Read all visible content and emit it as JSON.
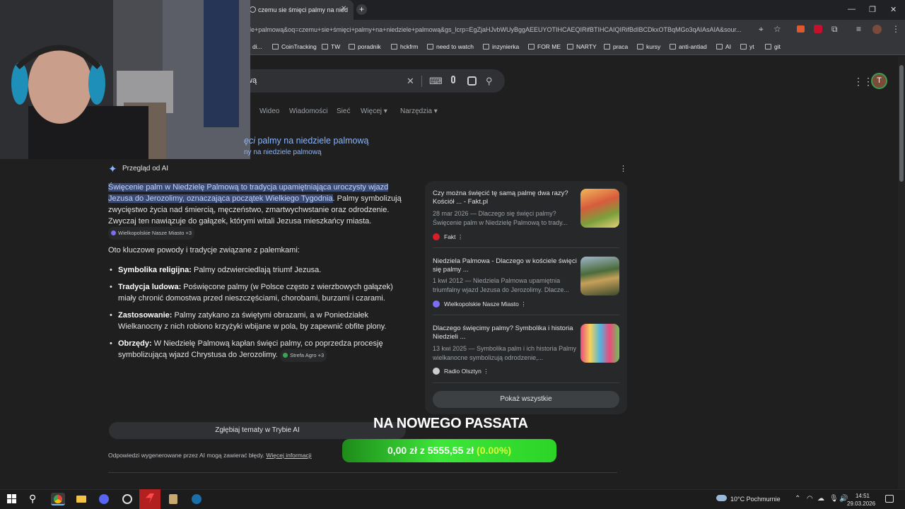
{
  "browser": {
    "tab_title": "czemu sie śmięci palmy na nied",
    "tab_close": "✕",
    "new_tab": "+",
    "window_controls": [
      "—",
      "❐",
      "✕"
    ],
    "url": "ele+palmową&oq=czemu+sie+śmięci+palmy+na+niedziele+palmową&gs_lcrp=EgZjaHJvbWUyBggAEEUYOTIHCAEQIRifBTIHCAIQIRifBdIBCDkxOTBqMGo3qAIAsAIA&sour..."
  },
  "bookmarks": [
    {
      "label": "di..."
    },
    {
      "label": "CoinTracking"
    },
    {
      "label": "TW"
    },
    {
      "label": "poradnik"
    },
    {
      "label": "hckfrm"
    },
    {
      "label": "need to watch"
    },
    {
      "label": "inzynierka"
    },
    {
      "label": "FOR ME"
    },
    {
      "label": "NARTY"
    },
    {
      "label": "praca"
    },
    {
      "label": "kursy"
    },
    {
      "label": "anti-antiad"
    },
    {
      "label": "AI"
    },
    {
      "label": "yt"
    },
    {
      "label": "git"
    }
  ],
  "search": {
    "query_visible": "wą",
    "avatar_letter": "T"
  },
  "nav_tabs": [
    "Wideo",
    "Wiadomości",
    "Sieć",
    "Więcej ▾",
    "Narzędzia ▾"
  ],
  "spelling": {
    "title_prefix": "ęci",
    "title_rest": " palmy na niedziele palmową",
    "subtitle": "ny na niedziele palmową"
  },
  "ai_overview": {
    "label": "Przegląd od AI",
    "highlight1": "Święcenie palm w Niedzielę Palmową",
    "highlight2": " to ",
    "highlight3": "tradycja upamiętniająca uroczysty wjazd Jezusa do Jerozolimy, oznaczająca początek Wielkiego Tygodnia",
    "rest": ". Palmy symbolizują zwycięstwo życia nad śmiercią, męczeństwo, zmartwychwstanie oraz odrodzenie. Zwyczaj ten nawiązuje do gałązek, którymi witali Jezusa mieszkańcy miasta.",
    "chip1": "Wielkopolskie Nasze Miasto +3",
    "intro": "Oto kluczowe powody i tradycje związane z palemkami:",
    "bullets": [
      {
        "head": "Symbolika religijna:",
        "text": " Palmy odzwierciedlają triumf Jezusa."
      },
      {
        "head": "Tradycja ludowa:",
        "text": " Poświęcone palmy (w Polsce często z wierzbowych gałązek) miały chronić domostwa przed nieszczęściami, chorobami, burzami i czarami."
      },
      {
        "head": "Zastosowanie:",
        "text": " Palmy zatykano za świętymi obrazami, a w Poniedziałek Wielkanocny z nich robiono krzyżyki wbijane w pola, by zapewnić obfite plony."
      },
      {
        "head": "Obrzędy:",
        "text": " W Niedzielę Palmową kapłan święci palmy, co poprzedza procesję symbolizującą wjazd Chrystusa do Jerozolimy."
      }
    ],
    "chip2": "Strefa Agro +3",
    "deep_dive": "Zgłębiaj tematy w Trybie AI",
    "disclaimer": "Odpowiedzi wygenerowane przez AI mogą zawierać błędy.",
    "more_info": "Więcej informacji"
  },
  "sources": [
    {
      "title": "Czy można święcić tę samą palmę dwa razy? Kościół ... - Fakt.pl",
      "snippet": "28 mar 2026 — Dlaczego się święci palmy? Święcenie palm w Niedzielę Palmową to trady...",
      "site": "Fakt",
      "icon_color": "#d81e2b"
    },
    {
      "title": "Niedziela Palmowa - Dlaczego w kościele święci się palmy ...",
      "snippet": "1 kwi 2012 — Niedziela Palmowa upamiętnia triumfalny wjazd Jezusa do Jerozolimy. Dlacze...",
      "site": "Wielkopolskie Nasze Miasto",
      "icon_color": "#7b6ef6"
    },
    {
      "title": "Dlaczego święcimy palmy? Symbolika i historia Niedzieli ...",
      "snippet": "13 kwi 2025 — Symbolika palm i ich historia Palmy wielkanocne symbolizują odrodzenie,...",
      "site": "Radio Olsztyn",
      "icon_color": "#cccccc"
    }
  ],
  "show_all": "Pokaż wszystkie",
  "overlay": {
    "title": "NA NOWEGO PASSATA",
    "amount": "0,00 zł",
    "of": " z ",
    "goal": "5555,55 zł",
    "percent": " (0.00%)"
  },
  "taskbar": {
    "weather": "10°C  Pochmurnie",
    "time": "14:51",
    "date": "29.03.2026"
  }
}
